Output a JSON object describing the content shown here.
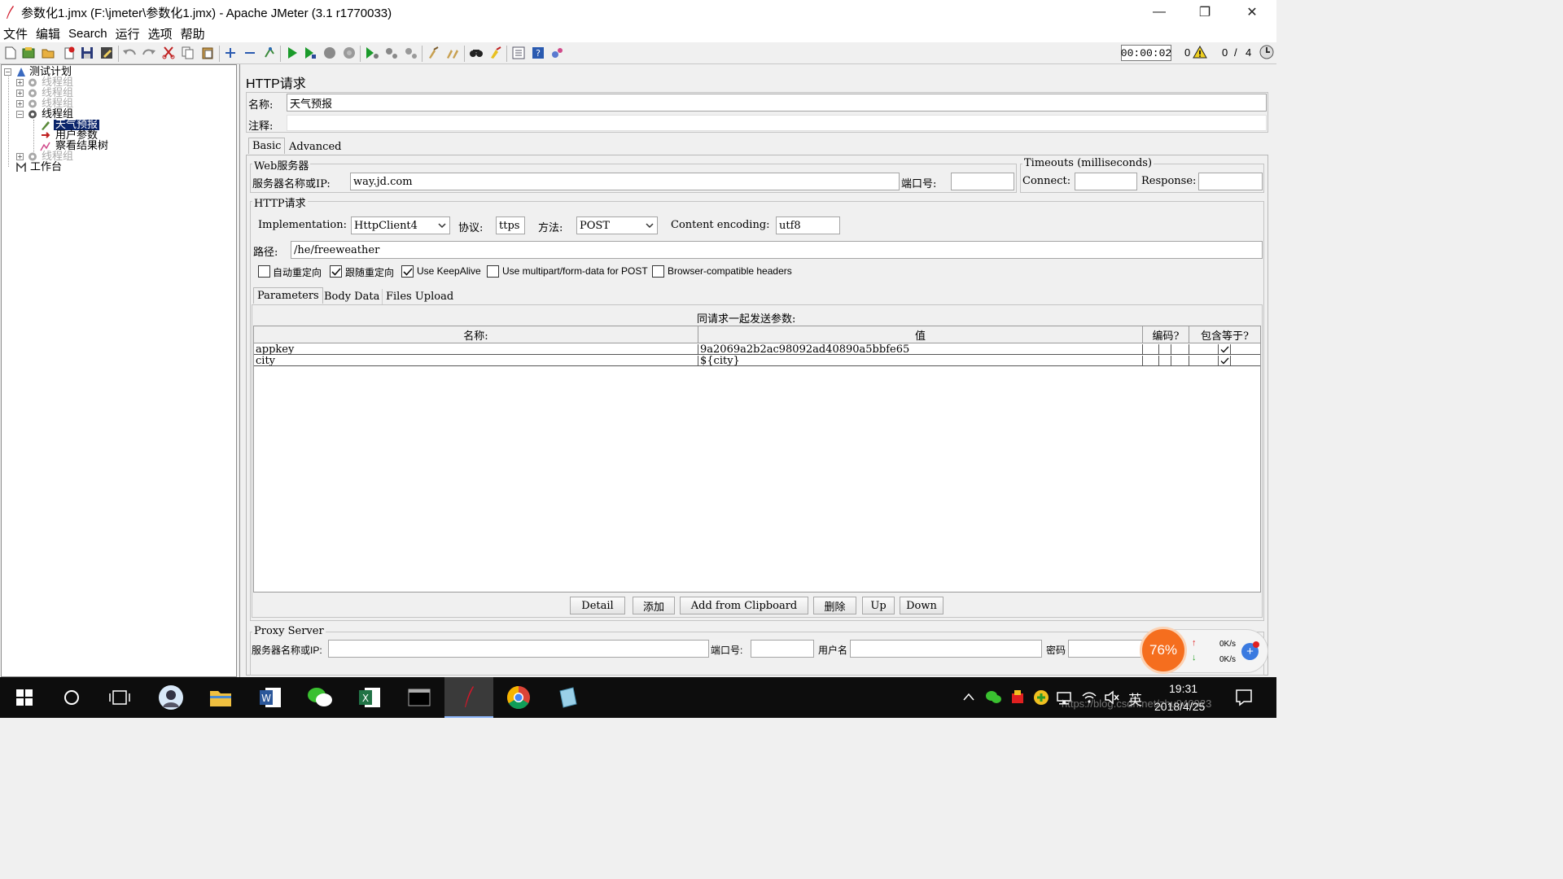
{
  "window": {
    "title": "参数化1.jmx (F:\\jmeter\\参数化1.jmx) - Apache JMeter (3.1 r1770033)",
    "minimize": "—",
    "maximize": "❐",
    "close": "✕"
  },
  "menu": [
    "文件",
    "编辑",
    "Search",
    "运行",
    "选项",
    "帮助"
  ],
  "status": {
    "timer": "00:00:02",
    "warnings": "0",
    "threads_active": "0",
    "threads_sep": "/",
    "threads_total": "4"
  },
  "tree": {
    "root": "测试计划",
    "tg1": "线程组",
    "tg2": "线程组",
    "tg3": "线程组",
    "tg4": "线程组",
    "sampler": "天气预报",
    "params": "用户参数",
    "listener": "察看结果树",
    "tg5": "线程组",
    "workbench": "工作台"
  },
  "panel": {
    "title": "HTTP请求",
    "name_label": "名称:",
    "name_value": "天气预报",
    "comment_label": "注释:",
    "comment_value": "",
    "tabs": [
      "Basic",
      "Advanced"
    ],
    "web_server_legend": "Web服务器",
    "server_label": "服务器名称或IP:",
    "server_value": "way.jd.com",
    "port_label": "端口号:",
    "port_value": "",
    "timeouts_legend": "Timeouts (milliseconds)",
    "connect_label": "Connect:",
    "connect_value": "",
    "response_label": "Response:",
    "response_value": "",
    "http_legend": "HTTP请求",
    "impl_label": "Implementation:",
    "impl_value": "HttpClient4",
    "protocol_label": "协议:",
    "protocol_value": "ttps",
    "method_label": "方法:",
    "method_value": "POST",
    "encoding_label": "Content encoding:",
    "encoding_value": "utf8",
    "path_label": "路径:",
    "path_value": "/he/freeweather",
    "checkboxes": [
      {
        "label": "自动重定向",
        "checked": false
      },
      {
        "label": "跟随重定向",
        "checked": true
      },
      {
        "label": "Use KeepAlive",
        "checked": true
      },
      {
        "label": "Use multipart/form-data for POST",
        "checked": false
      },
      {
        "label": "Browser-compatible headers",
        "checked": false
      }
    ],
    "subtabs": [
      "Parameters",
      "Body Data",
      "Files Upload"
    ],
    "params_caption": "同请求一起发送参数:",
    "columns": [
      "名称:",
      "值",
      "编码?",
      "包含等于?"
    ],
    "rows": [
      {
        "name": "appkey",
        "value": "9a2069a2b2ac98092ad40890a5bbfe65",
        "encode": false,
        "include_equals": true
      },
      {
        "name": "city",
        "value": "${city}",
        "encode": false,
        "include_equals": true
      }
    ],
    "buttons": {
      "detail": "Detail",
      "add": "添加",
      "add_clipboard": "Add from Clipboard",
      "delete": "删除",
      "up": "Up",
      "down": "Down"
    },
    "proxy_legend": "Proxy Server",
    "proxy_server_label": "服务器名称或IP:",
    "proxy_port_label": "端口号:",
    "proxy_user_label": "用户名",
    "proxy_pass_label": "密码"
  },
  "overlay": {
    "percent": "76%",
    "up_speed": "0K/s",
    "down_speed": "0K/s",
    "watermark": "https://blog.csdn.net/zhu940923"
  },
  "taskbar": {
    "ime": "英",
    "time": "19:31",
    "date": "2018/4/25"
  },
  "colors": {
    "selection": "#0a246a",
    "taskbar": "#0d0d0d",
    "gauge": "#f56e1e"
  }
}
